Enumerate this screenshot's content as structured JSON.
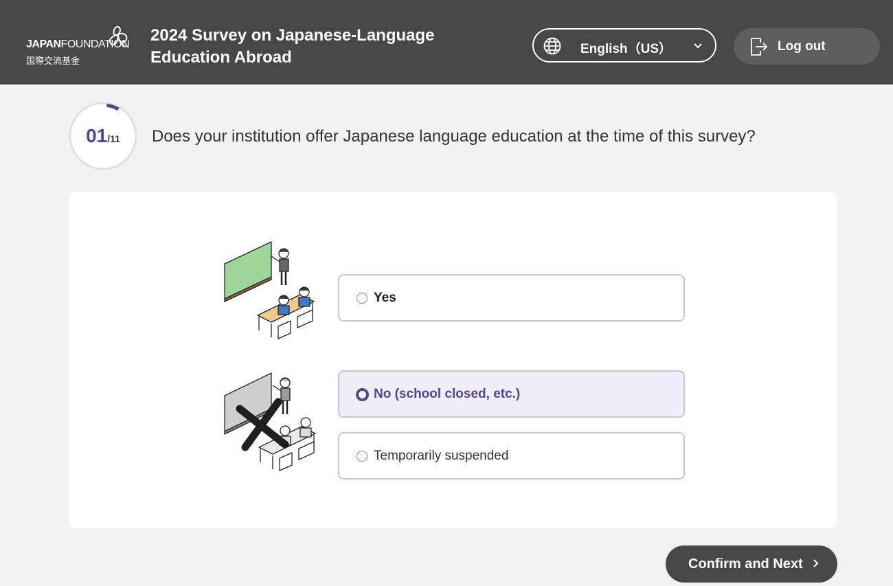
{
  "header": {
    "logo_en_bold": "JAPAN",
    "logo_en_light": "FOUNDATION",
    "logo_jp": "国際交流基金",
    "title_line1": "2024 Survey on Japanese-Language",
    "title_line2": "Education Abroad",
    "language": "English（US）",
    "logout_label": "Log out"
  },
  "progress": {
    "current": "01",
    "total": "/11",
    "fraction": 0.0909,
    "accent_color": "#574394"
  },
  "question": {
    "text": "Does your institution offer Japanese language education at the time of this survey?"
  },
  "options": [
    {
      "label": "Yes",
      "selected": false
    },
    {
      "label": "No (school closed, etc.)",
      "selected": true
    },
    {
      "label": "Temporarily suspended",
      "selected": false
    }
  ],
  "footer": {
    "confirm_label": "Confirm and Next"
  },
  "colors": {
    "header_bg": "#474747",
    "page_bg": "#f2f2f2",
    "selected_bg": "#f1eefc",
    "accent": "#574394"
  },
  "icons": [
    "globe-icon",
    "chevron-down-icon",
    "logout-icon",
    "chevron-right-icon"
  ]
}
